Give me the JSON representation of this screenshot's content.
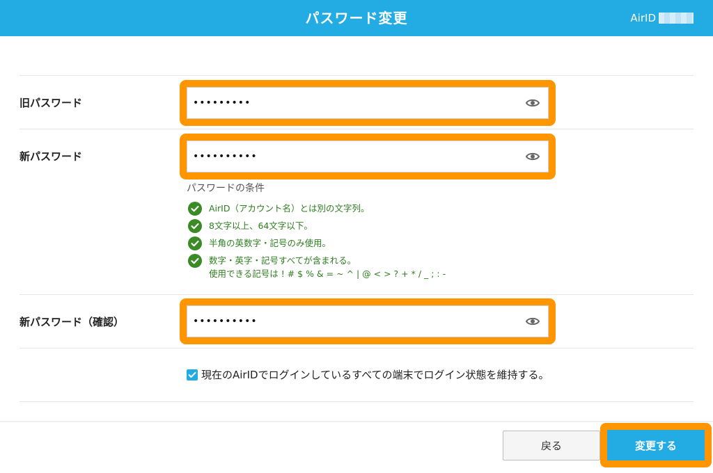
{
  "header": {
    "title": "パスワード変更",
    "account_label": "AirID"
  },
  "form": {
    "old_password": {
      "label": "旧パスワード",
      "value": "•••••••••"
    },
    "new_password": {
      "label": "新パスワード",
      "value": "••••••••••"
    },
    "conditions": {
      "title": "パスワードの条件",
      "items": [
        "AirID（アカウント名）とは別の文字列。",
        "8文字以上、64文字以下。",
        "半角の英数字・記号のみ使用。",
        "数字・英字・記号すべてが含まれる。"
      ],
      "symbols_note": "使用できる記号は ! # $ % & = ~ ^ | @ < > ? + * / _ ; : -"
    },
    "confirm_password": {
      "label": "新パスワード（確認）",
      "value": "••••••••••"
    },
    "keep_login": {
      "label": "現在のAirIDでログインしているすべての端末でログイン状態を維持する。",
      "checked": true
    }
  },
  "footer": {
    "back_label": "戻る",
    "submit_label": "変更する"
  },
  "icons": {
    "eye": "eye-icon",
    "check": "check-circle-icon"
  },
  "colors": {
    "brand": "#22ace3",
    "highlight": "#ff9500",
    "success": "#2e7d1f"
  }
}
